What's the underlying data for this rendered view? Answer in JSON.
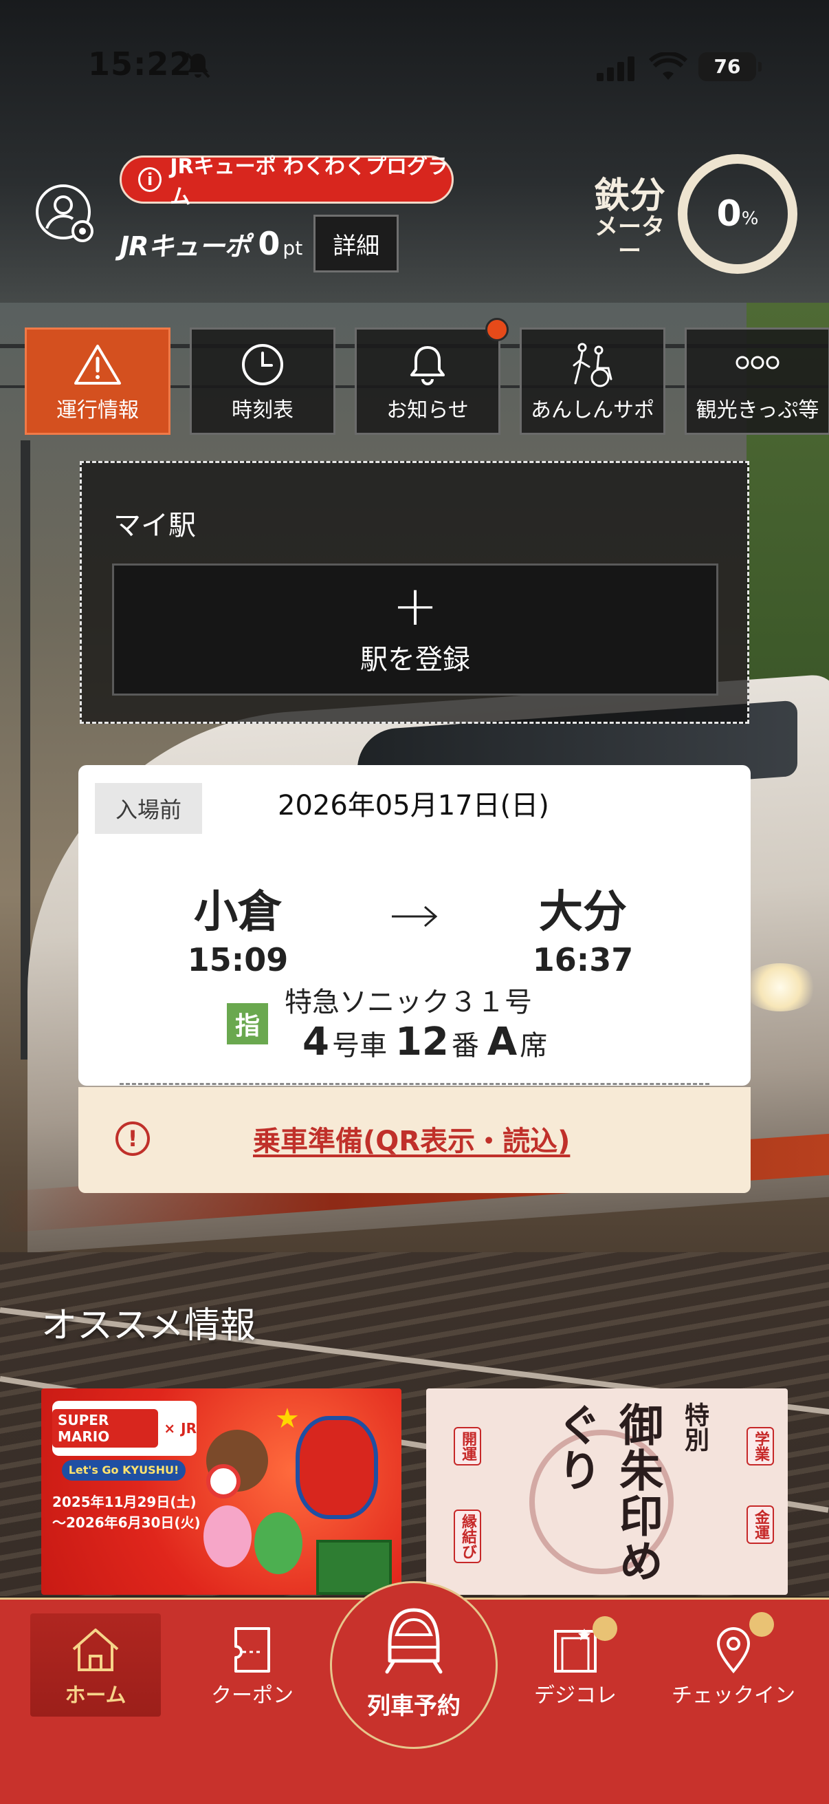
{
  "status_bar": {
    "time": "15:22",
    "battery": "76"
  },
  "header": {
    "program_badge": "JRキューポ わくわくプログラム",
    "points_brand": "JRキューポ",
    "points_value": "0",
    "points_unit": "pt",
    "detail_button": "詳細",
    "meter_label_line1": "鉄分",
    "meter_label_line2": "メーター",
    "meter_value": "0",
    "meter_unit": "%",
    "meter_fraction": 0
  },
  "quick_menu": [
    {
      "label": "運行情報",
      "icon": "warning-icon",
      "active": true
    },
    {
      "label": "時刻表",
      "icon": "clock-icon",
      "active": false
    },
    {
      "label": "お知らせ",
      "icon": "bell-icon",
      "active": false,
      "has_badge": true
    },
    {
      "label": "あんしんサポ",
      "icon": "accessibility-icon",
      "active": false
    },
    {
      "label": "観光きっぷ等",
      "icon": "more-icon",
      "active": false
    }
  ],
  "my_station": {
    "title": "マイ駅",
    "add_label": "駅を登録"
  },
  "ticket": {
    "status": "入場前",
    "date": "2026年05月17日(日)",
    "from_station": "小倉",
    "from_time": "15:09",
    "to_station": "大分",
    "to_time": "16:37",
    "reserved_mark": "指",
    "train_name": "特急ソニック３１号",
    "car_number": "4",
    "car_unit": "号車",
    "seat_number": "12",
    "seat_unit": "番",
    "seat_letter": "A",
    "seat_suffix": "席"
  },
  "boarding": {
    "link_text": "乗車準備(QR表示・読込)"
  },
  "recommendations": {
    "title": "オススメ情報",
    "mario_banner": {
      "brand": "SUPER MARIO",
      "partner": "JR",
      "subtitle": "Let's Go KYUSHU!",
      "date_start": "2025年11月29日(土)",
      "date_end": "〜2026年6月30日(火)"
    },
    "goshuin_banner": {
      "special": "特別",
      "title": "御朱印めぐり",
      "tags": [
        "開運",
        "縁結び",
        "学業",
        "金運"
      ]
    }
  },
  "bottom_nav": {
    "home": "ホーム",
    "coupon": "クーポン",
    "train_reserve": "列車予約",
    "digicolle": "デジコレ",
    "checkin": "チェックイン"
  },
  "colors": {
    "accent_red": "#c8322c",
    "active_orange": "#d4501f",
    "gold": "#e6c68c",
    "reserved_green": "#6aa84f"
  }
}
